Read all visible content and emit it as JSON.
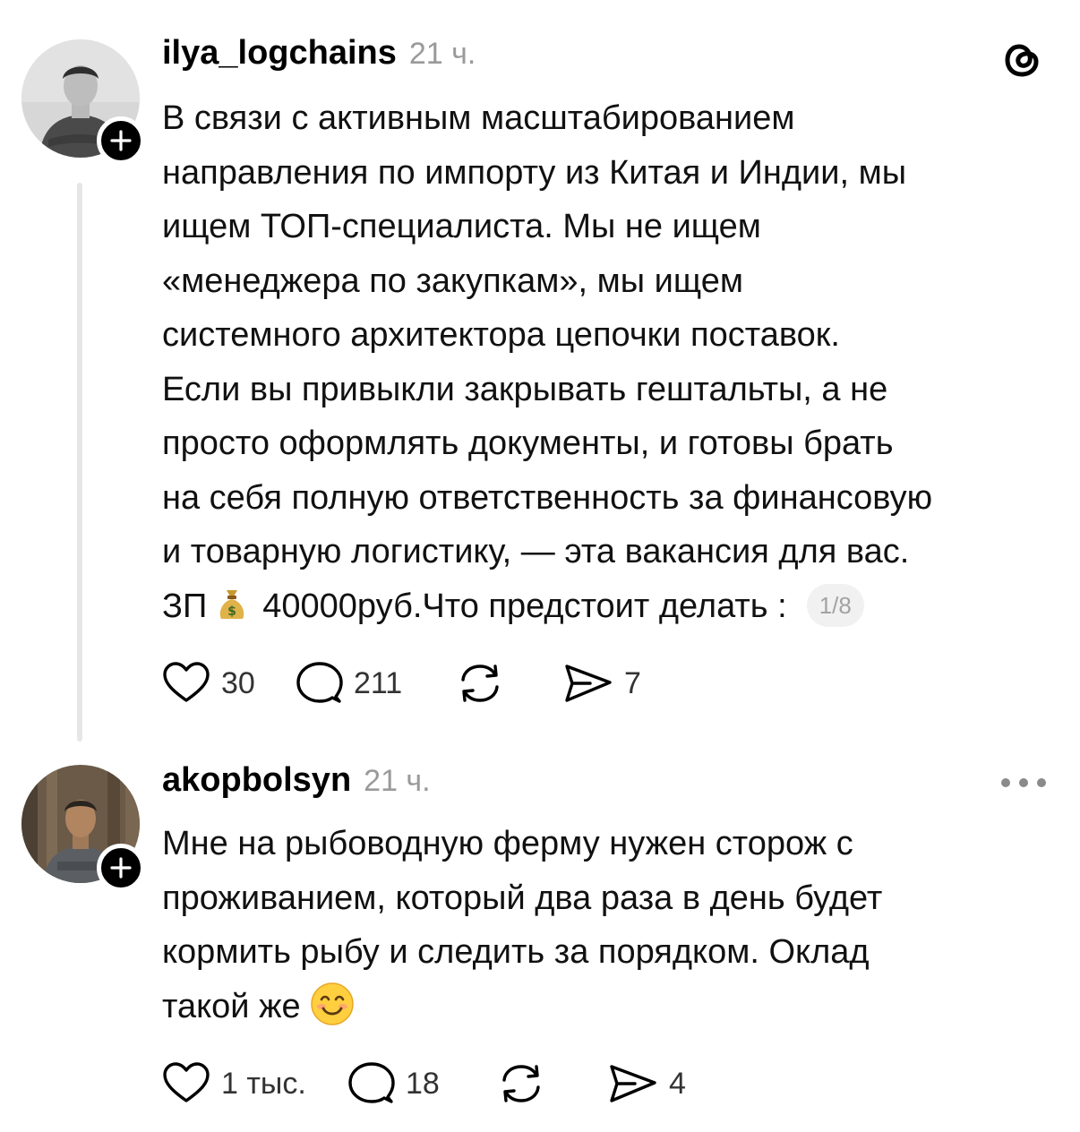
{
  "posts": [
    {
      "username": "ilya_logchains",
      "time": "21 ч.",
      "lines": [
        "В связи с активным масштабированием",
        "направления по импорту из Китая и Индии, мы",
        "ищем ТОП-специалиста. Мы не ищем",
        "«менеджера по закупкам», мы ищем",
        "системного архитектора цепочки поставок.",
        "Если вы привыкли закрывать гештальты, а не",
        "просто оформлять документы, и готовы брать",
        "на себя полную ответственность за финансовую",
        "и товарную логистику, — эта вакансия для вас."
      ],
      "last_line_prefix": "ЗП",
      "last_line_suffix": "40000руб.Что предстоит делать :",
      "page_indicator": "1/8",
      "likes": "30",
      "replies": "211",
      "shares": "7",
      "icons": [
        "plus-icon",
        "threads-logo-icon",
        "moneybag-icon",
        "heart-icon",
        "comment-icon",
        "repost-icon",
        "share-icon"
      ]
    },
    {
      "username": "akopbolsyn",
      "time": "21 ч.",
      "lines": [
        "Мне на рыбоводную ферму нужен сторож с",
        "проживанием, который два раза в день будет",
        "кормить рыбу и следить за порядком. Оклад"
      ],
      "last_line": "такой же",
      "likes": "1 тыс.",
      "replies": "18",
      "shares": "4",
      "icons": [
        "plus-icon",
        "more-icon",
        "smiling-emoji-icon",
        "heart-icon",
        "comment-icon",
        "repost-icon",
        "share-icon"
      ]
    }
  ],
  "colors": {
    "text": "#111111",
    "timestamp": "#9a9a9a",
    "thread_line": "#e6e6e6",
    "pill_bg": "#f1f1f1"
  }
}
